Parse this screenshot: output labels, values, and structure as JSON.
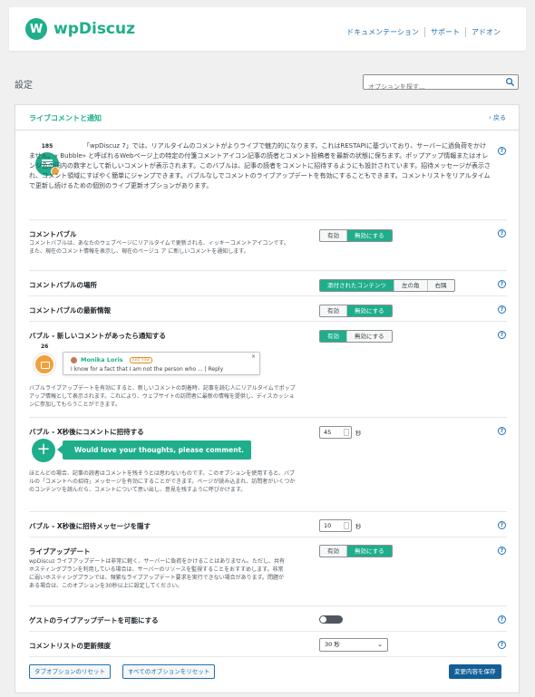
{
  "header": {
    "brand": "wpDiscuz",
    "logo_letter": "W",
    "nav": [
      "ドキュメンテーション",
      "サポート",
      "アドオン"
    ]
  },
  "page": {
    "title": "設定",
    "search_placeholder": "オプションを探す..."
  },
  "panel": {
    "title": "ライブコメントと通知",
    "back_label": "戻る",
    "intro_count": "185",
    "intro_text": "「wpDiscuz 7」では、リアルタイムのコメントがよりライブで魅力的になります。これはRESTAPIに基づいており、サーバーに過負荷をかけません。« Bubble» と呼ばれるWebページ上の特定の付箋コメントアイコン記事の読者とコメント投稿者を最新の状態に保ちます。ポップアップ情報またはオレンジ色の円内の数字として新しいコメントが表示されます。このバブルは、記事の読者をコメントに招待するようにも設計されています。招待メッセージが表示され、コメント領域にすばやく簡単にジャンプできます。バブルなしでコメントのライブアップデートを有効にすることもできます。コメントリストをリアルタイムで更新し続けるための個別のライブ更新オプションがあります。"
  },
  "options": {
    "bubble": {
      "label": "コメントバブル",
      "desc": "コメントバブルは、あなたのウェブページにリアルタイムで更新される、ィッキーコメントアイコンです。また、現在のコメント情報を表示し、現在のページュ ア に新しいコメントを通知します。",
      "choices": [
        "有効",
        "無効にする"
      ],
      "selected": "無効にする"
    },
    "location": {
      "label": "コメントバブルの場所",
      "choices": [
        "添付されたコンテンツ",
        "左の角",
        "右隅"
      ],
      "selected": "添付されたコンテンツ"
    },
    "live_info": {
      "label": "コメントバブルの最新情報",
      "choices": [
        "有効",
        "無効にする"
      ],
      "selected": "無効にする"
    },
    "notify_new": {
      "label": "バブル - 新しいコメントがあったら通知する",
      "choices": [
        "有効",
        "無効にする"
      ],
      "selected": "有効",
      "preview_count": "26",
      "preview_name": "Monika Loris",
      "preview_tag": "just now",
      "preview_message": "I know for a fact that I am not the person who ... | Reply",
      "desc": "バブルライブアップデートを有効にすると、新しいコメントの到着時、記事を読む人にリアルタイムでポップアップ情報として表示されます。これにより、ウェブサイトの訪問者に最新の情報を提供し、ディスカッションに参加してもらうことができます。"
    },
    "invite": {
      "label": "バブル - X秒後にコメントに招待する",
      "value": "45",
      "unit": "秒",
      "preview_text": "Would love your thoughts, please comment.",
      "desc": "ほとんどの場合、記事の読者はコメントを残そうとは思わないものです。このオプションを使用すると、バブルの「コメントへの招待」メッセージを有効にすることができます。ページが読み込まれ、訪問者がいくつかのコンテンツを読んだら、コメントについて思い出し、意見を残すように呼びかけます。"
    },
    "hide_invite": {
      "label": "バブル - X秒後に招待メッセージを隠す",
      "value": "10",
      "unit": "秒"
    },
    "live_update": {
      "label": "ライブアップデート",
      "desc": "wpDiscuz ライブアップデートは非常に軽く、サーバーに負荷をかけることはありません。ただし、共有ホスティングプランを利用している場合は、サーバーのリソースを監視することをおすすめします。非常に弱いホスティングプランでは、頻繁なライブアップデート要求を実行できない場合があります。問題がある場合は、このオプションを30秒以上に設定してください。",
      "choices": [
        "有効",
        "無効にする"
      ],
      "selected": "無効にする"
    },
    "guest_live": {
      "label": "ゲストのライブアップデートを可能にする",
      "enabled": false
    },
    "refresh": {
      "label": "コメントリストの更新頻度",
      "value": "30 秒"
    }
  },
  "footer": {
    "reset_tab": "タブオプションのリセット",
    "reset_all": "すべてのオプションをリセット",
    "save": "変更内容を保存"
  },
  "colors": {
    "accent": "#1fae8b",
    "link": "#2271b1",
    "primary_button": "#135e96",
    "badge": "#f0a13c"
  }
}
